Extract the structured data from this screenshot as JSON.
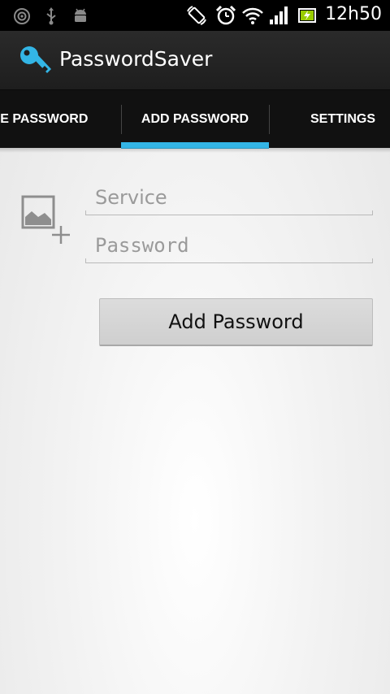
{
  "status_bar": {
    "time": "12h50",
    "icons": [
      "radio-icon",
      "usb-icon",
      "android-debug-icon",
      "rotate-icon",
      "alarm-clock-icon",
      "wifi-icon",
      "signal-icon",
      "battery-charging-icon"
    ]
  },
  "action_bar": {
    "app_icon": "key-icon",
    "title": "PasswordSaver",
    "accent_color": "#33b5e5"
  },
  "tabs": [
    {
      "label": "USE PASSWORD",
      "selected": false
    },
    {
      "label": "ADD PASSWORD",
      "selected": true
    },
    {
      "label": "SETTINGS",
      "selected": false
    }
  ],
  "form": {
    "image_button_icon": "add-image-icon",
    "service": {
      "value": "",
      "placeholder": "Service"
    },
    "password": {
      "value": "",
      "placeholder": "Password"
    },
    "submit_label": "Add Password"
  }
}
